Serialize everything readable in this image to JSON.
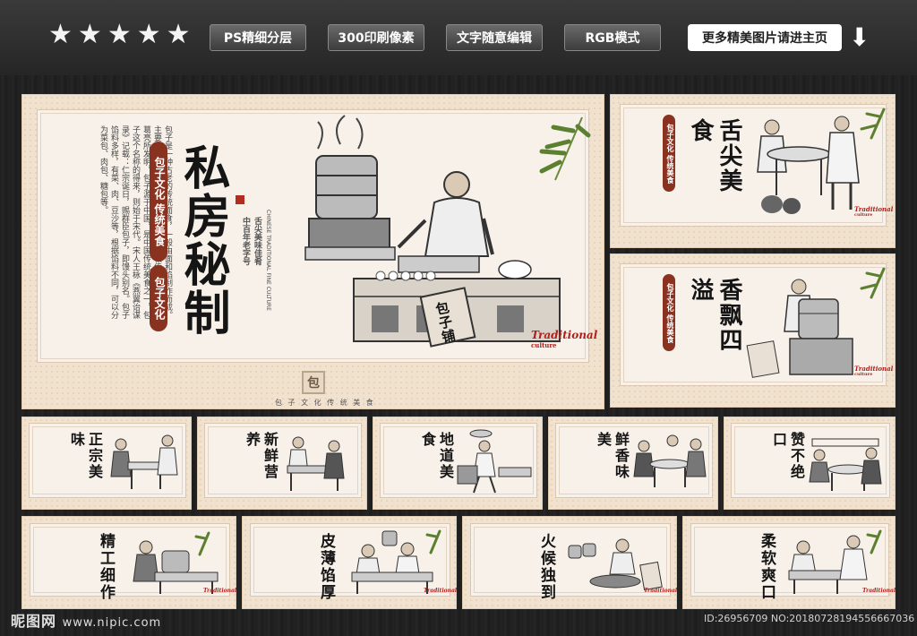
{
  "topbar": {
    "stars": [
      "★",
      "★",
      "★",
      "★",
      "★"
    ],
    "tags": [
      "PS精细分层",
      "300印刷像素",
      "文字随意编辑",
      "RGB模式"
    ],
    "more_label": "更多精美图片请进主页",
    "arrow": "⬇"
  },
  "main_panel": {
    "title": "私房秘制",
    "tag1": "包子文化 传统美食",
    "tag2": "包子文化",
    "slogan1": "中百年老字号",
    "slogan2": "舌尖美味佳肴",
    "english_vertical": "CHINESE TRADITIONAL FINE CULTURE",
    "sign": "包子铺",
    "culture": "Traditional",
    "culture_sub": "culture",
    "bao_mark": "包",
    "bottom_line": "包 子 文 化 传 统 美 食",
    "body_text": "包子是一种古老的传统面食，一般由面和馅制作而成。主要用料有面粉和馅，起源于四川，相传由三国时期诸葛亮所发明。包子源于中国，是中国传统美食之一，包子这个名称的得来，则始于宋代。宋人王栐《燕翼诒谋录》记载：仁宗诞日，赐群臣包子，即馒头别名。包子馅料多样，有菜、肉、豆沙等，根据馅料不同，可以分为菜包、肉包、糖包等。"
  },
  "side_panels": [
    {
      "title": "舌尖美食",
      "tag1": "包子文化 传统美食",
      "tag2": "包子文化",
      "culture": "Traditional",
      "culture_sub": "culture"
    },
    {
      "title": "香飘四溢",
      "tag1": "包子文化 传统美食",
      "tag2": "包子文化",
      "culture": "Traditional",
      "culture_sub": "culture"
    }
  ],
  "row1": [
    {
      "title": "正宗美味"
    },
    {
      "title": "新鲜营养"
    },
    {
      "title": "地道美食"
    },
    {
      "title": "鲜香味美"
    },
    {
      "title": "赞不绝口"
    }
  ],
  "row2": [
    {
      "title": "精工细作",
      "culture": "Traditional"
    },
    {
      "title": "皮薄馅厚",
      "culture": "Traditional"
    },
    {
      "title": "火候独到",
      "culture": "Traditional"
    },
    {
      "title": "柔软爽口",
      "culture": "Traditional"
    }
  ],
  "watermark": {
    "site": "昵图网",
    "url": "www.nipic.com",
    "id": "ID:26956709 NO:20180728194556667036"
  },
  "colors": {
    "accent_red": "#8a3220",
    "panel_bg": "#f1e2cf",
    "page_bg": "#1c1c1c"
  }
}
